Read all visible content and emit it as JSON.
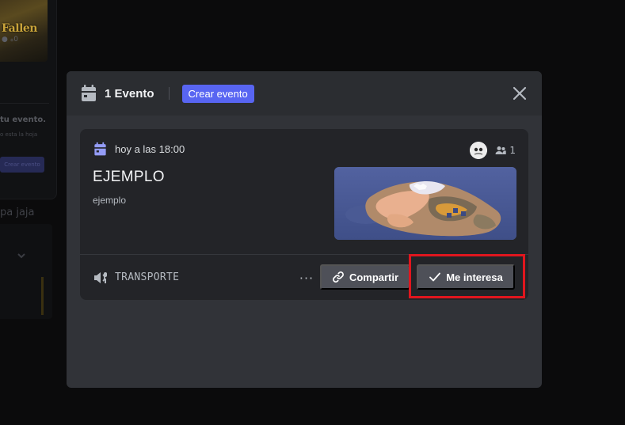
{
  "background": {
    "thumb_logo": "Fallen",
    "mini_icons": "● ⁎0",
    "card_text": "tu evento.",
    "card_subtext": "o esta la hoja",
    "card_button": "Crear evento",
    "heading": "pa jaja"
  },
  "modal": {
    "title": "1 Evento",
    "create_event_label": "Crear evento",
    "close_icon": "close-icon",
    "event": {
      "date": "hoy a las 18:00",
      "interested_count": "1",
      "title": "EJEMPLO",
      "description": "ejemplo",
      "location": "TRANSPORTE",
      "more_label": "···",
      "share_label": "Compartir",
      "interested_label": "Me interesa"
    }
  },
  "colors": {
    "accent": "#5865f2",
    "modal_bg": "#313338",
    "card_bg": "#232428",
    "button_gray": "#4e5058",
    "highlight": "#e0161e"
  }
}
